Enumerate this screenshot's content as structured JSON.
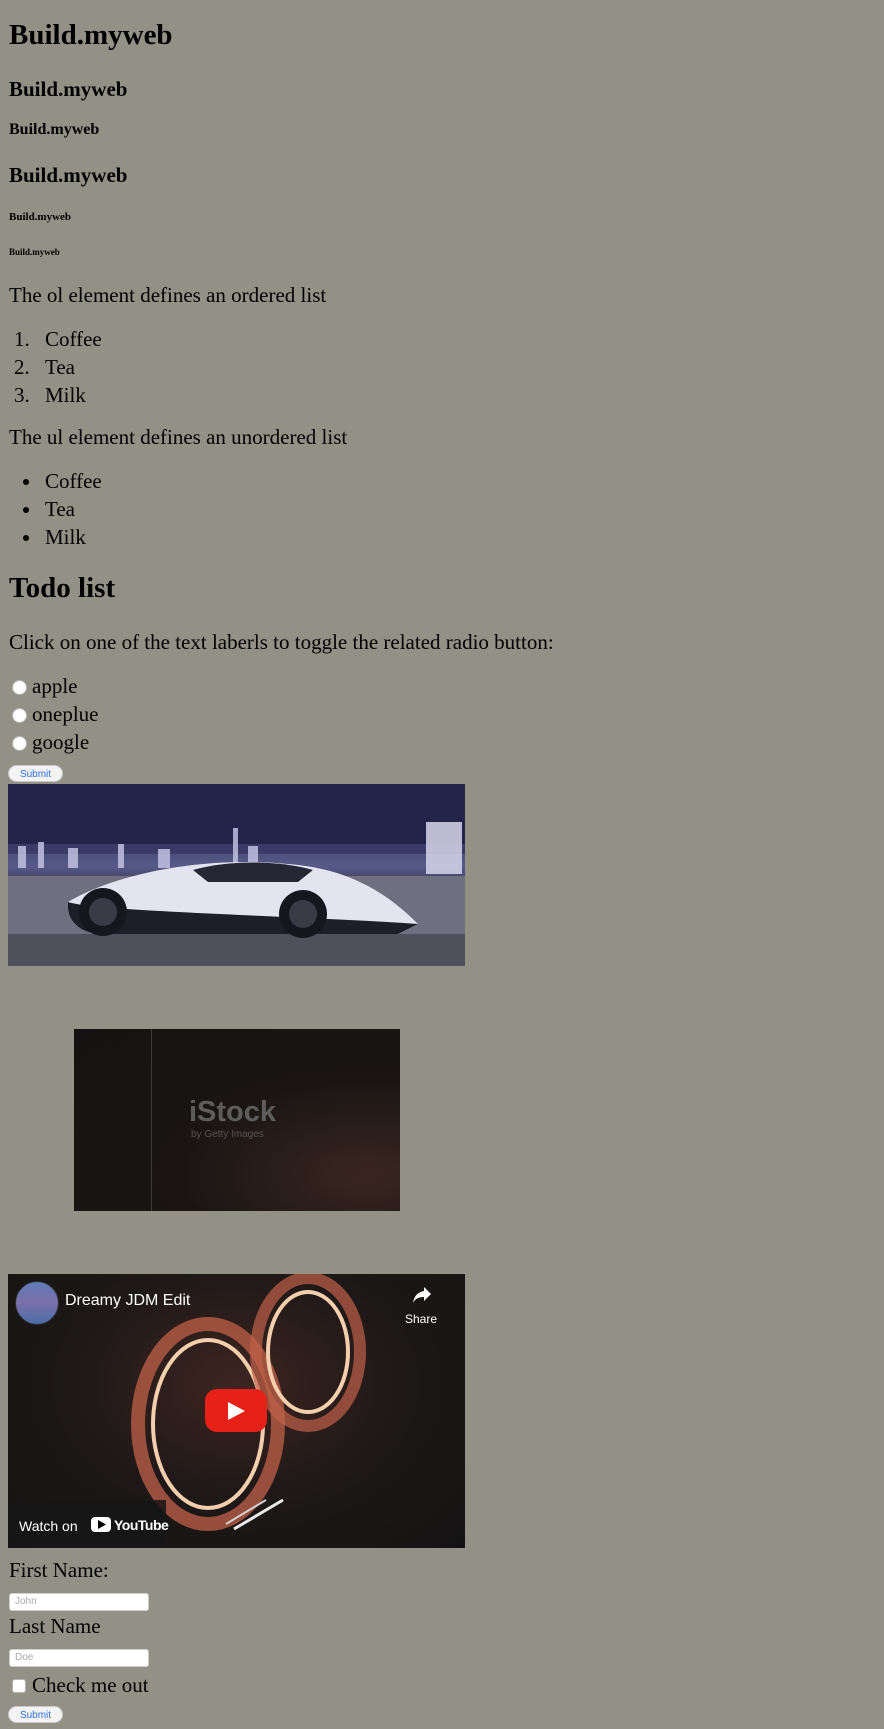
{
  "headings": {
    "h1": "Build.myweb",
    "h2": "Build.myweb",
    "h3": "Build.myweb",
    "h4": "Build.myweb",
    "h5": "Build.myweb",
    "h6": "Build.myweb"
  },
  "ordered_list": {
    "intro": "The ol element defines an ordered list",
    "items": [
      {
        "number": "1.",
        "label": "Coffee"
      },
      {
        "number": "2.",
        "label": "Tea"
      },
      {
        "number": "3.",
        "label": "Milk"
      }
    ]
  },
  "unordered_list": {
    "intro": "The ul element defines an unordered list",
    "items": [
      "Coffee",
      "Tea",
      "Milk"
    ]
  },
  "todo": {
    "title": "Todo list",
    "description": "Click on one of the text laberls to toggle the related radio button:",
    "options": [
      "apple",
      "oneplue",
      "google"
    ],
    "submit_label": "Submit"
  },
  "images": {
    "istock_logo": "iStock",
    "istock_sub": "by Getty Images"
  },
  "video": {
    "title": "Dreamy JDM Edit",
    "share_label": "Share",
    "watch_on_label": "Watch on",
    "youtube_label": "YouTube"
  },
  "form": {
    "first_name_label": "First Name:",
    "first_name_placeholder": "John",
    "last_name_label": "Last Name",
    "last_name_placeholder": "Doe",
    "checkbox_label": "Check me out",
    "submit_label": "Submit"
  },
  "colors": {
    "page_background": "#939185",
    "button_text": "#2d6fd6",
    "youtube_red": "#e62117"
  }
}
